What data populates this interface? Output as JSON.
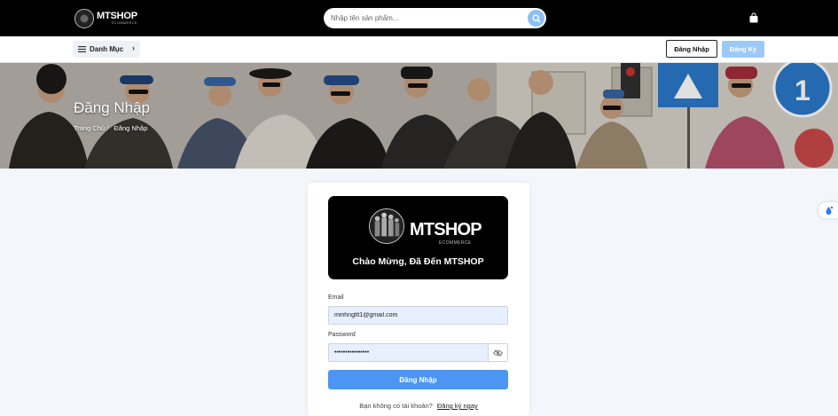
{
  "header": {
    "brand": "MTSHOP",
    "brand_sub": "ECOMMERCE",
    "search_placeholder": "Nhập tên sản phẩm...",
    "search_icon": "search-icon",
    "cart_icon": "shopping-bag-icon"
  },
  "subnav": {
    "category_label": "Danh Mục",
    "menu_icon": "hamburger-icon",
    "chevron_icon": "chevron-right-icon",
    "login_label": "Đăng Nhập",
    "register_label": "Đăng Ký"
  },
  "banner": {
    "title": "Đăng Nhập",
    "breadcrumb_home": "Trang Chủ /",
    "breadcrumb_current": "Đăng Nhập"
  },
  "login": {
    "brand": "MTSHOP",
    "brand_sub": "ECOMMERCE",
    "welcome": "Chào Mừng, Đã Đến MTSHOP",
    "email_label": "Email",
    "email_value": "minhngltt1@gmail.com",
    "password_label": "Password",
    "password_value": "••••••••••••••••",
    "eye_icon": "eye-off-icon",
    "submit_label": "Đăng Nhập",
    "no_account_text": "Bạn không có tài khoản?",
    "register_link": "Đăng ký ngay"
  },
  "colors": {
    "topbar": "#000000",
    "primary": "#4d95f2",
    "register_button": "#9cc9f7",
    "page_bg": "#f3f6fb"
  }
}
